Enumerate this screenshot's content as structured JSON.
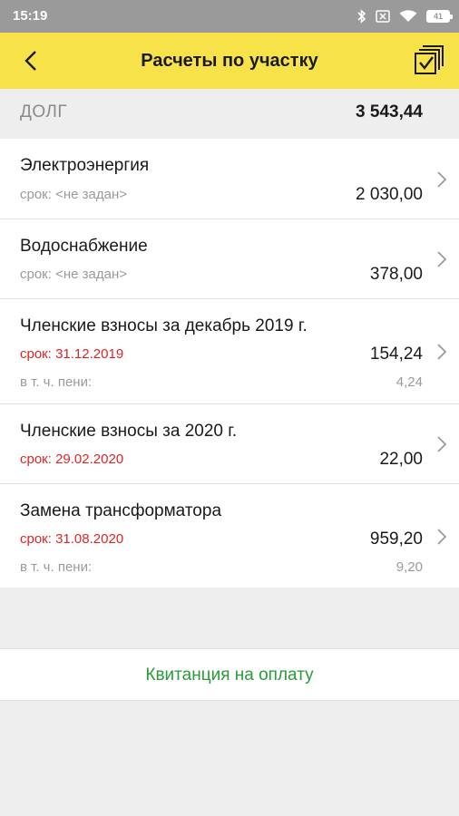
{
  "status_bar": {
    "time": "15:19",
    "battery": "41",
    "icons": [
      "bluetooth-icon",
      "sim-off-icon",
      "wifi-icon",
      "battery-icon"
    ]
  },
  "header": {
    "title": "Расчеты по участку",
    "back_icon": "chevron-left-icon",
    "action_icon": "checklist-icon"
  },
  "debt": {
    "label": "ДОЛГ",
    "amount": "3 543,44"
  },
  "items": [
    {
      "name": "Электроэнергия",
      "due": "срок: <не задан>",
      "amount": "2 030,00"
    },
    {
      "name": "Водоснабжение",
      "due": "срок: <не задан>",
      "amount": "378,00"
    },
    {
      "name": "Членские взносы за декабрь 2019 г.",
      "due": "срок: 31.12.2019",
      "amount": "154,24",
      "peni_label": "в т. ч. пени:",
      "peni_amount": "4,24"
    },
    {
      "name": "Членские взносы за 2020 г.",
      "due": "срок: 29.02.2020",
      "amount": "22,00"
    },
    {
      "name": "Замена трансформатора",
      "due": "срок: 31.08.2020",
      "amount": "959,20",
      "peni_label": "в т. ч. пени:",
      "peni_amount": "9,20"
    }
  ],
  "receipt_button": "Квитанция на оплату",
  "colors": {
    "header_bg": "#f7e24a",
    "overdue": "#e02424",
    "action_green": "#2a9a3a"
  }
}
